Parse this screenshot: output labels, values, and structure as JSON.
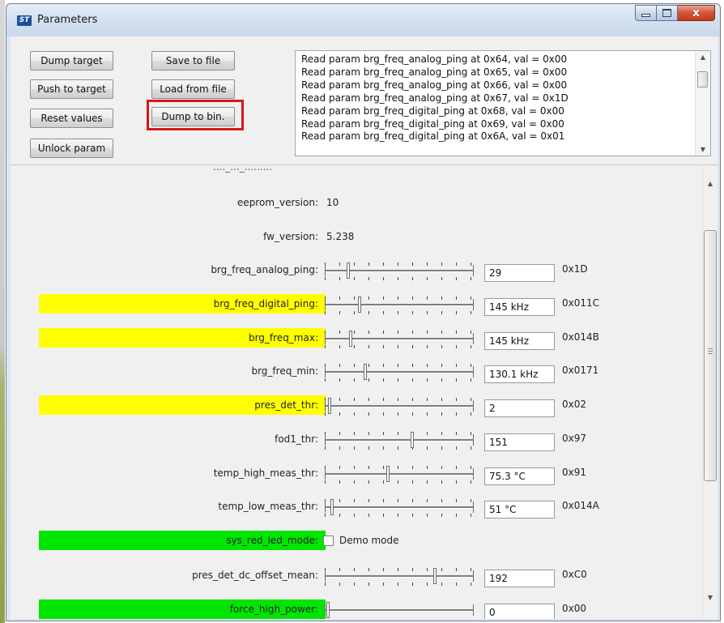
{
  "window": {
    "title": "Parameters",
    "close_glyph": "x"
  },
  "toolbar": {
    "dump_target": "Dump target",
    "push_to_target": "Push to target",
    "reset_values": "Reset values",
    "unlock_param": "Unlock param",
    "save_to_file": "Save to file",
    "load_from_file": "Load from file",
    "dump_to_bin": "Dump to bin."
  },
  "log": {
    "lines": [
      "Read param brg_freq_analog_ping at 0x64, val = 0x00",
      "Read param brg_freq_analog_ping at 0x65, val = 0x00",
      "Read param brg_freq_analog_ping at 0x66, val = 0x00",
      "Read param brg_freq_analog_ping at 0x67, val = 0x1D",
      "Read param brg_freq_digital_ping at 0x68, val = 0x00",
      "Read param brg_freq_digital_ping at 0x69, val = 0x00",
      "Read param brg_freq_digital_ping at 0x6A, val = 0x01"
    ]
  },
  "params": {
    "cut_row_label": "...._..._.........",
    "eeprom_version": {
      "label": "eeprom_version:",
      "value": "10"
    },
    "fw_version": {
      "label": "fw_version:",
      "value": "5.238"
    },
    "brg_freq_analog_ping": {
      "label": "brg_freq_analog_ping:",
      "field": "29",
      "hex": "0x1D",
      "level": 0.14
    },
    "brg_freq_digital_ping": {
      "label": "brg_freq_digital_ping:",
      "field": "145 kHz",
      "hex": "0x011C",
      "level": 0.22
    },
    "brg_freq_max": {
      "label": "brg_freq_max:",
      "field": "145 kHz",
      "hex": "0x014B",
      "level": 0.16
    },
    "brg_freq_min": {
      "label": "brg_freq_min:",
      "field": "130.1 kHz",
      "hex": "0x0171",
      "level": 0.26
    },
    "pres_det_thr": {
      "label": "pres_det_thr:",
      "field": "2",
      "hex": "0x02",
      "level": 0.01
    },
    "fod1_thr": {
      "label": "fod1_thr:",
      "field": "151",
      "hex": "0x97",
      "level": 0.59
    },
    "temp_high_meas_thr": {
      "label": "temp_high_meas_thr:",
      "field": "75.3 °C",
      "hex": "0x91",
      "level": 0.42
    },
    "temp_low_meas_thr": {
      "label": "temp_low_meas_thr:",
      "field": "51 °C",
      "hex": "0x014A",
      "level": 0.03
    },
    "sys_red_led_mode": {
      "label": "sys_red_led_mode:",
      "checkbox_label": "Demo mode",
      "checked": false
    },
    "pres_det_dc_offset_mean": {
      "label": "pres_det_dc_offset_mean:",
      "field": "192",
      "hex": "0xC0",
      "level": 0.75
    },
    "force_high_power": {
      "label": "force_high_power:",
      "field": "0",
      "hex": "0x00",
      "level": 0.0
    }
  },
  "colors": {
    "yellow_highlight": "#ffff00",
    "green_highlight": "#00e600",
    "red_focus_box": "#d9151b"
  }
}
